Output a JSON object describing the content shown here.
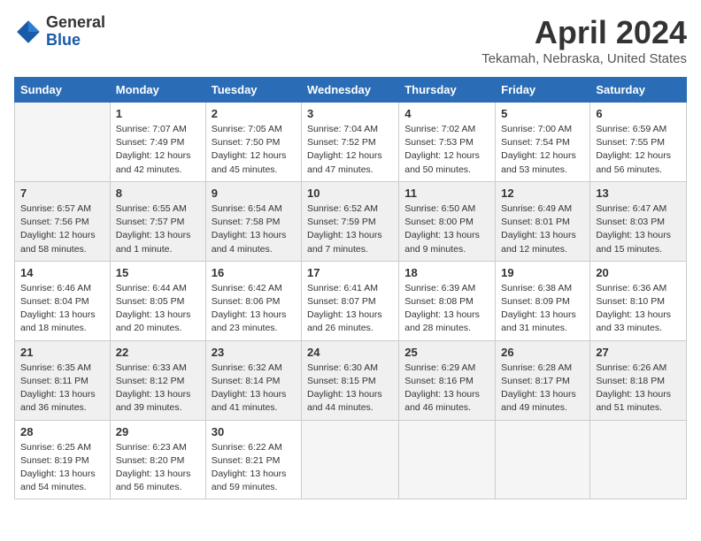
{
  "logo": {
    "general": "General",
    "blue": "Blue"
  },
  "title": "April 2024",
  "location": "Tekamah, Nebraska, United States",
  "days_of_week": [
    "Sunday",
    "Monday",
    "Tuesday",
    "Wednesday",
    "Thursday",
    "Friday",
    "Saturday"
  ],
  "weeks": [
    [
      {
        "day": "",
        "sunrise": "",
        "sunset": "",
        "daylight": ""
      },
      {
        "day": "1",
        "sunrise": "Sunrise: 7:07 AM",
        "sunset": "Sunset: 7:49 PM",
        "daylight": "Daylight: 12 hours and 42 minutes."
      },
      {
        "day": "2",
        "sunrise": "Sunrise: 7:05 AM",
        "sunset": "Sunset: 7:50 PM",
        "daylight": "Daylight: 12 hours and 45 minutes."
      },
      {
        "day": "3",
        "sunrise": "Sunrise: 7:04 AM",
        "sunset": "Sunset: 7:52 PM",
        "daylight": "Daylight: 12 hours and 47 minutes."
      },
      {
        "day": "4",
        "sunrise": "Sunrise: 7:02 AM",
        "sunset": "Sunset: 7:53 PM",
        "daylight": "Daylight: 12 hours and 50 minutes."
      },
      {
        "day": "5",
        "sunrise": "Sunrise: 7:00 AM",
        "sunset": "Sunset: 7:54 PM",
        "daylight": "Daylight: 12 hours and 53 minutes."
      },
      {
        "day": "6",
        "sunrise": "Sunrise: 6:59 AM",
        "sunset": "Sunset: 7:55 PM",
        "daylight": "Daylight: 12 hours and 56 minutes."
      }
    ],
    [
      {
        "day": "7",
        "sunrise": "Sunrise: 6:57 AM",
        "sunset": "Sunset: 7:56 PM",
        "daylight": "Daylight: 12 hours and 58 minutes."
      },
      {
        "day": "8",
        "sunrise": "Sunrise: 6:55 AM",
        "sunset": "Sunset: 7:57 PM",
        "daylight": "Daylight: 13 hours and 1 minute."
      },
      {
        "day": "9",
        "sunrise": "Sunrise: 6:54 AM",
        "sunset": "Sunset: 7:58 PM",
        "daylight": "Daylight: 13 hours and 4 minutes."
      },
      {
        "day": "10",
        "sunrise": "Sunrise: 6:52 AM",
        "sunset": "Sunset: 7:59 PM",
        "daylight": "Daylight: 13 hours and 7 minutes."
      },
      {
        "day": "11",
        "sunrise": "Sunrise: 6:50 AM",
        "sunset": "Sunset: 8:00 PM",
        "daylight": "Daylight: 13 hours and 9 minutes."
      },
      {
        "day": "12",
        "sunrise": "Sunrise: 6:49 AM",
        "sunset": "Sunset: 8:01 PM",
        "daylight": "Daylight: 13 hours and 12 minutes."
      },
      {
        "day": "13",
        "sunrise": "Sunrise: 6:47 AM",
        "sunset": "Sunset: 8:03 PM",
        "daylight": "Daylight: 13 hours and 15 minutes."
      }
    ],
    [
      {
        "day": "14",
        "sunrise": "Sunrise: 6:46 AM",
        "sunset": "Sunset: 8:04 PM",
        "daylight": "Daylight: 13 hours and 18 minutes."
      },
      {
        "day": "15",
        "sunrise": "Sunrise: 6:44 AM",
        "sunset": "Sunset: 8:05 PM",
        "daylight": "Daylight: 13 hours and 20 minutes."
      },
      {
        "day": "16",
        "sunrise": "Sunrise: 6:42 AM",
        "sunset": "Sunset: 8:06 PM",
        "daylight": "Daylight: 13 hours and 23 minutes."
      },
      {
        "day": "17",
        "sunrise": "Sunrise: 6:41 AM",
        "sunset": "Sunset: 8:07 PM",
        "daylight": "Daylight: 13 hours and 26 minutes."
      },
      {
        "day": "18",
        "sunrise": "Sunrise: 6:39 AM",
        "sunset": "Sunset: 8:08 PM",
        "daylight": "Daylight: 13 hours and 28 minutes."
      },
      {
        "day": "19",
        "sunrise": "Sunrise: 6:38 AM",
        "sunset": "Sunset: 8:09 PM",
        "daylight": "Daylight: 13 hours and 31 minutes."
      },
      {
        "day": "20",
        "sunrise": "Sunrise: 6:36 AM",
        "sunset": "Sunset: 8:10 PM",
        "daylight": "Daylight: 13 hours and 33 minutes."
      }
    ],
    [
      {
        "day": "21",
        "sunrise": "Sunrise: 6:35 AM",
        "sunset": "Sunset: 8:11 PM",
        "daylight": "Daylight: 13 hours and 36 minutes."
      },
      {
        "day": "22",
        "sunrise": "Sunrise: 6:33 AM",
        "sunset": "Sunset: 8:12 PM",
        "daylight": "Daylight: 13 hours and 39 minutes."
      },
      {
        "day": "23",
        "sunrise": "Sunrise: 6:32 AM",
        "sunset": "Sunset: 8:14 PM",
        "daylight": "Daylight: 13 hours and 41 minutes."
      },
      {
        "day": "24",
        "sunrise": "Sunrise: 6:30 AM",
        "sunset": "Sunset: 8:15 PM",
        "daylight": "Daylight: 13 hours and 44 minutes."
      },
      {
        "day": "25",
        "sunrise": "Sunrise: 6:29 AM",
        "sunset": "Sunset: 8:16 PM",
        "daylight": "Daylight: 13 hours and 46 minutes."
      },
      {
        "day": "26",
        "sunrise": "Sunrise: 6:28 AM",
        "sunset": "Sunset: 8:17 PM",
        "daylight": "Daylight: 13 hours and 49 minutes."
      },
      {
        "day": "27",
        "sunrise": "Sunrise: 6:26 AM",
        "sunset": "Sunset: 8:18 PM",
        "daylight": "Daylight: 13 hours and 51 minutes."
      }
    ],
    [
      {
        "day": "28",
        "sunrise": "Sunrise: 6:25 AM",
        "sunset": "Sunset: 8:19 PM",
        "daylight": "Daylight: 13 hours and 54 minutes."
      },
      {
        "day": "29",
        "sunrise": "Sunrise: 6:23 AM",
        "sunset": "Sunset: 8:20 PM",
        "daylight": "Daylight: 13 hours and 56 minutes."
      },
      {
        "day": "30",
        "sunrise": "Sunrise: 6:22 AM",
        "sunset": "Sunset: 8:21 PM",
        "daylight": "Daylight: 13 hours and 59 minutes."
      },
      {
        "day": "",
        "sunrise": "",
        "sunset": "",
        "daylight": ""
      },
      {
        "day": "",
        "sunrise": "",
        "sunset": "",
        "daylight": ""
      },
      {
        "day": "",
        "sunrise": "",
        "sunset": "",
        "daylight": ""
      },
      {
        "day": "",
        "sunrise": "",
        "sunset": "",
        "daylight": ""
      }
    ]
  ]
}
